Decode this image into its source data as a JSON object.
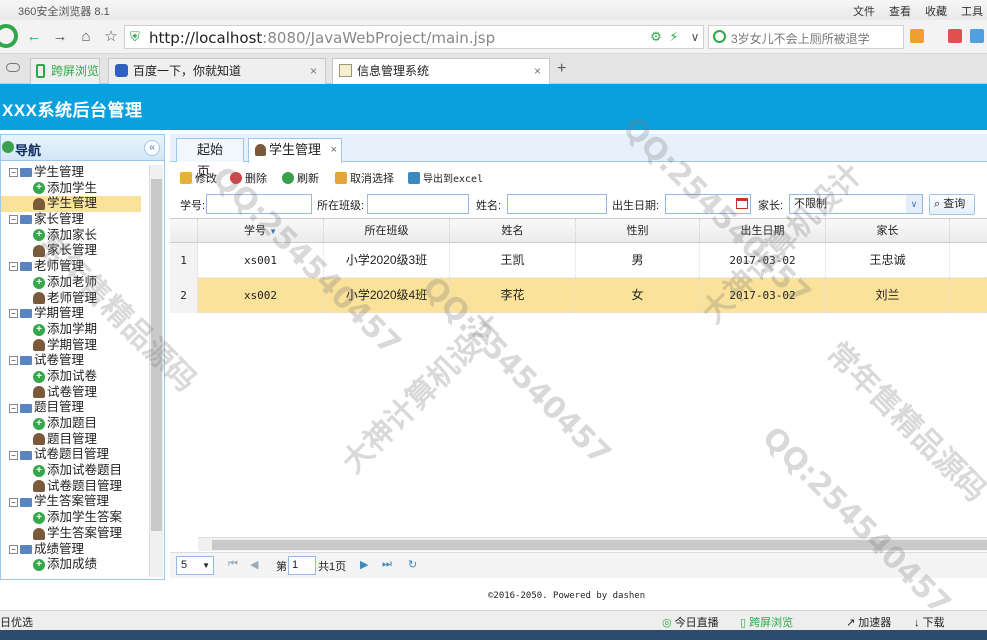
{
  "browser": {
    "title": "360安全浏览器 8.1",
    "menus": [
      "文件",
      "查看",
      "收藏",
      "工具"
    ],
    "url_host": "http://localhost",
    "url_rest": ":8080/JavaWebProject/main.jsp",
    "search_text": "3岁女儿不会上厕所被退学",
    "tabs": [
      "跨屏浏览",
      "百度一下，你就知道",
      "信息管理系统"
    ]
  },
  "app": {
    "title": "XXX系统后台管理",
    "nav_title": "导航",
    "tree": [
      {
        "label": "学生管理",
        "children": [
          {
            "label": "添加学生",
            "icon": "plus"
          },
          {
            "label": "学生管理",
            "icon": "user",
            "selected": true
          }
        ]
      },
      {
        "label": "家长管理",
        "children": [
          {
            "label": "添加家长",
            "icon": "plus"
          },
          {
            "label": "家长管理",
            "icon": "user"
          }
        ]
      },
      {
        "label": "老师管理",
        "children": [
          {
            "label": "添加老师",
            "icon": "plus"
          },
          {
            "label": "老师管理",
            "icon": "user"
          }
        ]
      },
      {
        "label": "学期管理",
        "children": [
          {
            "label": "添加学期",
            "icon": "plus"
          },
          {
            "label": "学期管理",
            "icon": "user"
          }
        ]
      },
      {
        "label": "试卷管理",
        "children": [
          {
            "label": "添加试卷",
            "icon": "plus"
          },
          {
            "label": "试卷管理",
            "icon": "user"
          }
        ]
      },
      {
        "label": "题目管理",
        "children": [
          {
            "label": "添加题目",
            "icon": "plus"
          },
          {
            "label": "题目管理",
            "icon": "user"
          }
        ]
      },
      {
        "label": "试卷题目管理",
        "children": [
          {
            "label": "添加试卷题目",
            "icon": "plus"
          },
          {
            "label": "试卷题目管理",
            "icon": "user"
          }
        ]
      },
      {
        "label": "学生答案管理",
        "children": [
          {
            "label": "添加学生答案",
            "icon": "plus"
          },
          {
            "label": "学生答案管理",
            "icon": "user"
          }
        ]
      },
      {
        "label": "成绩管理",
        "children": [
          {
            "label": "添加成绩",
            "icon": "plus"
          }
        ]
      }
    ],
    "content_tabs": [
      "起始页",
      "学生管理"
    ],
    "toolbar": {
      "edit": "修改",
      "delete": "删除",
      "refresh": "刷新",
      "cancel": "取消选择",
      "export": "导出到excel"
    },
    "search": {
      "student_no": "学号:",
      "class": "所在班级:",
      "name": "姓名:",
      "birth": "出生日期:",
      "parent": "家长:",
      "parent_value": "不限制",
      "query": "查询"
    },
    "grid": {
      "columns": [
        "学号",
        "所在班级",
        "姓名",
        "性别",
        "出生日期",
        "家长"
      ],
      "rows": [
        {
          "num": "1",
          "no": "xs001",
          "cls": "小学2020级3班",
          "name": "王凯",
          "sex": "男",
          "birth": "2017-03-02",
          "parent": "王忠诚"
        },
        {
          "num": "2",
          "no": "xs002",
          "cls": "小学2020级4班",
          "name": "李花",
          "sex": "女",
          "birth": "2017-03-02",
          "parent": "刘兰"
        }
      ]
    },
    "pager": {
      "size": "5",
      "page_prefix": "第",
      "page": "1",
      "total": "共1页"
    },
    "footer": "©2016-2050. Powered by dashen"
  },
  "statusbar": {
    "left": "日优选",
    "live": "今日直播",
    "cross": "跨屏浏览",
    "accel": "加速器",
    "download": "下载"
  },
  "watermarks": [
    "大神计算机设计",
    "QQ:254540457",
    "常年售精品源码"
  ],
  "colors": {
    "header": "#09a1dd",
    "selected_row": "#fbe29a",
    "border": "#9cc8ea"
  }
}
